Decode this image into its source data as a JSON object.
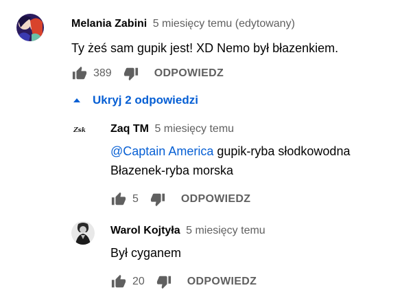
{
  "comment": {
    "author": "Melania Zabini",
    "time": "5 miesięcy temu (edytowany)",
    "text": "Ty żeś sam gupik jest! XD Nemo był błazenkiem.",
    "likes": "389",
    "reply_label": "ODPOWIEDZ"
  },
  "replies_toggle": {
    "label": "Ukryj 2 odpowiedzi"
  },
  "replies": [
    {
      "author": "Zaq TM",
      "avatar_text": "Zsk",
      "time": "5 miesięcy temu",
      "mention": "@Captain America",
      "text_line1": " gupik-ryba słodkowodna",
      "text_line2": "Błazenek-ryba morska",
      "likes": "5",
      "reply_label": "ODPOWIEDZ"
    },
    {
      "author": "Warol Kojtyła",
      "time": "5 miesięcy temu",
      "text": "Był cyganem",
      "likes": "20",
      "reply_label": "ODPOWIEDZ"
    }
  ],
  "colors": {
    "link_blue": "#065fd4",
    "secondary_text": "#606060",
    "icon_gray": "#606060"
  },
  "icons": {
    "like": "thumb-up-icon",
    "dislike": "thumb-down-icon",
    "toggle": "caret-up-icon"
  }
}
